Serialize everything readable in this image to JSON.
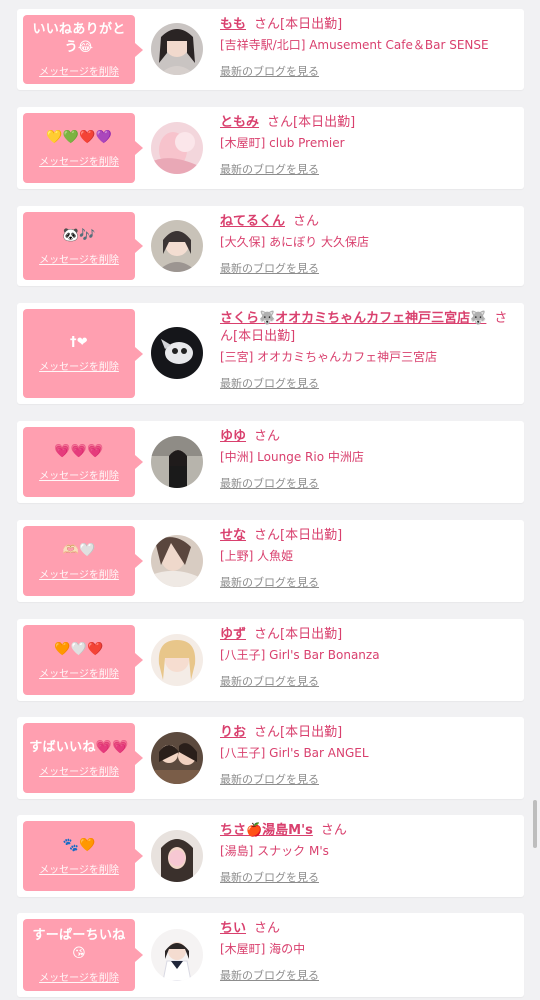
{
  "delete_label": "メッセージを削除",
  "honorific": "さん",
  "blog_label": "最新のブログを見る",
  "items": [
    {
      "message": "いいねありがとう😂",
      "name": "もも",
      "status": "[本日出勤]",
      "shop": "[吉祥寺駅/北口] Amusement Cafe＆Bar SENSE"
    },
    {
      "message": "💛💚❤️💜",
      "name": "ともみ",
      "status": "[本日出勤]",
      "shop": "[木屋町] club Premier"
    },
    {
      "message": "🐼🎶",
      "name": "ねてるくん",
      "status": "",
      "shop": "[大久保] あにぼり 大久保店"
    },
    {
      "message": "†❤",
      "name": "さくら🐺オオカミちゃんカフェ神戸三宮店🐺",
      "status": "[本日出勤]",
      "shop": "[三宮] オオカミちゃんカフェ神戸三宮店"
    },
    {
      "message": "💗💗💗",
      "name": "ゆゆ",
      "status": "",
      "shop": "[中洲] Lounge Rio 中洲店"
    },
    {
      "message": "🫶🏻🤍",
      "name": "せな",
      "status": "[本日出勤]",
      "shop": "[上野] 人魚姫"
    },
    {
      "message": "🧡🤍❤️",
      "name": "ゆず",
      "status": "[本日出勤]",
      "shop": "[八王子] Girl's Bar Bonanza"
    },
    {
      "message": "すばいいね💗💗",
      "name": "りお",
      "status": "[本日出勤]",
      "shop": "[八王子] Girl's Bar ANGEL"
    },
    {
      "message": "🐾🧡",
      "name": "ちさ🍎湯島M's",
      "status": "",
      "shop": "[湯島] スナック M's"
    },
    {
      "message": "すーぱーちいね😘",
      "name": "ちい",
      "status": "",
      "shop": "[木屋町] 海の中"
    }
  ],
  "colors": {
    "bubble": "#ff9fb0",
    "accent": "#d9406e",
    "muted": "#8d8d8d",
    "background": "#f1f1f3"
  }
}
